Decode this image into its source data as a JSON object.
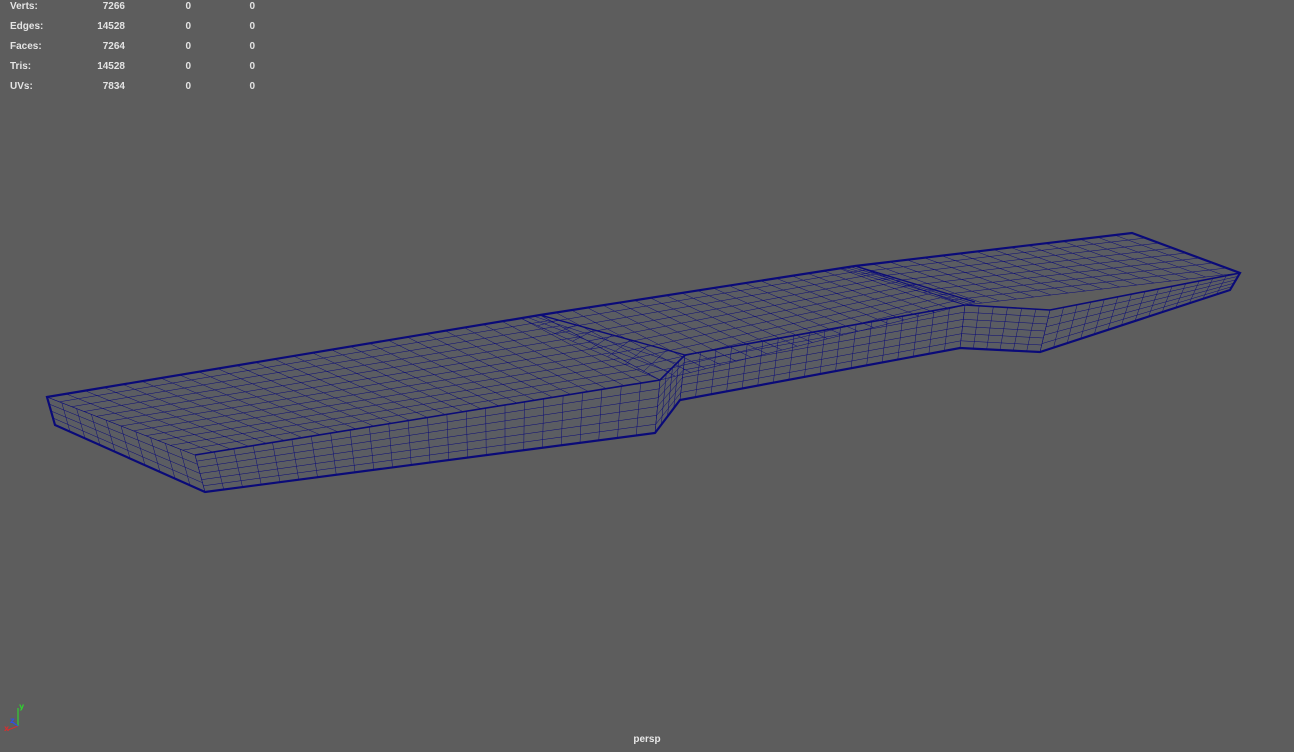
{
  "hud": {
    "rows": [
      {
        "label": "Verts:",
        "total": "7266",
        "selected": "0",
        "component": "0"
      },
      {
        "label": "Edges:",
        "total": "14528",
        "selected": "0",
        "component": "0"
      },
      {
        "label": "Faces:",
        "total": "7264",
        "selected": "0",
        "component": "0"
      },
      {
        "label": "Tris:",
        "total": "14528",
        "selected": "0",
        "component": "0"
      },
      {
        "label": "UVs:",
        "total": "7834",
        "selected": "0",
        "component": "0"
      }
    ]
  },
  "viewport": {
    "camera": "persp",
    "background_color": "#5d5d5d",
    "wireframe_color": "#0a0a78"
  },
  "axis_gizmo": {
    "x_label": "x",
    "y_label": "y",
    "z_label": "z",
    "x_color": "#d23030",
    "y_color": "#30d030",
    "z_color": "#3050e0"
  }
}
